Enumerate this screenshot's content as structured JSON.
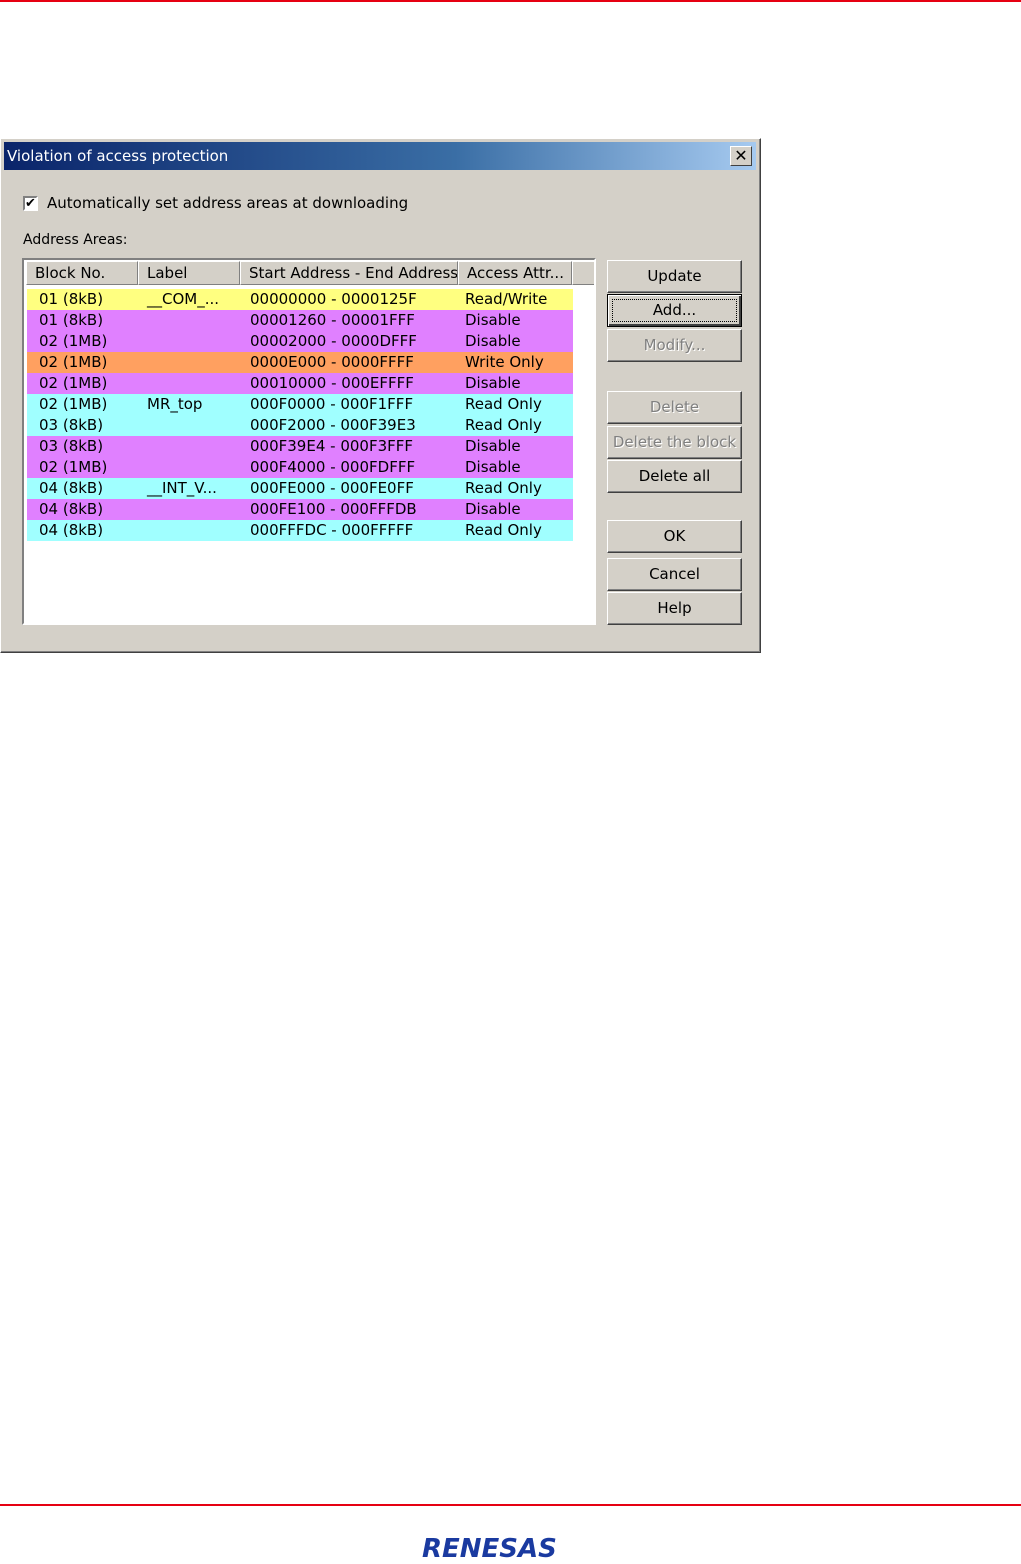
{
  "dialog": {
    "title": "Violation of access protection",
    "close_glyph": "✕",
    "auto_set_checked": true,
    "auto_set_label": "Automatically set address areas at downloading",
    "address_areas_label": "Address Areas:",
    "columns": [
      "Block No.",
      "Label",
      "Start Address - End Address",
      "Access Attr..."
    ],
    "rows": [
      {
        "block": "01 (8kB)",
        "label": "__COM_...",
        "range": "00000000 - 0000125F",
        "attr": "Read/Write",
        "color": "#ffff80"
      },
      {
        "block": "01 (8kB)",
        "label": "",
        "range": "00001260 - 00001FFF",
        "attr": "Disable",
        "color": "#e080ff"
      },
      {
        "block": "02 (1MB)",
        "label": "",
        "range": "00002000 - 0000DFFF",
        "attr": "Disable",
        "color": "#e080ff"
      },
      {
        "block": "02 (1MB)",
        "label": "",
        "range": "0000E000 - 0000FFFF",
        "attr": "Write Only",
        "color": "#ffa060"
      },
      {
        "block": "02 (1MB)",
        "label": "",
        "range": "00010000 - 000EFFFF",
        "attr": "Disable",
        "color": "#e080ff"
      },
      {
        "block": "02 (1MB)",
        "label": "MR_top",
        "range": "000F0000 - 000F1FFF",
        "attr": "Read Only",
        "color": "#a0ffff"
      },
      {
        "block": "03 (8kB)",
        "label": "",
        "range": "000F2000 - 000F39E3",
        "attr": "Read Only",
        "color": "#a0ffff"
      },
      {
        "block": "03 (8kB)",
        "label": "",
        "range": "000F39E4 - 000F3FFF",
        "attr": "Disable",
        "color": "#e080ff"
      },
      {
        "block": "02 (1MB)",
        "label": "",
        "range": "000F4000 - 000FDFFF",
        "attr": "Disable",
        "color": "#e080ff"
      },
      {
        "block": "04 (8kB)",
        "label": "__INT_V...",
        "range": "000FE000 - 000FE0FF",
        "attr": "Read Only",
        "color": "#a0ffff"
      },
      {
        "block": "04 (8kB)",
        "label": "",
        "range": "000FE100 - 000FFFDB",
        "attr": "Disable",
        "color": "#e080ff"
      },
      {
        "block": "04 (8kB)",
        "label": "",
        "range": "000FFFDC - 000FFFFF",
        "attr": "Read Only",
        "color": "#a0ffff"
      }
    ],
    "buttons": {
      "update": "Update",
      "add": "Add...",
      "modify": "Modify...",
      "delete": "Delete",
      "delete_block": "Delete the block",
      "delete_all": "Delete all",
      "ok": "OK",
      "cancel": "Cancel",
      "help": "Help"
    }
  },
  "page": {
    "logo_text": "RENESAS",
    "accent_color": "#e60012",
    "logo_color": "#1a3aa0"
  }
}
